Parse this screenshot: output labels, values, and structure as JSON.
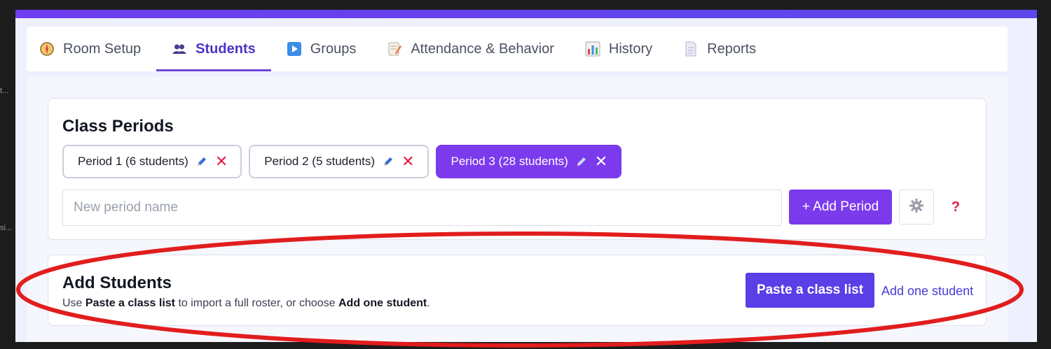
{
  "tabs": [
    {
      "label": "Room Setup",
      "icon": "compass-icon",
      "active": false
    },
    {
      "label": "Students",
      "icon": "people-icon",
      "active": true
    },
    {
      "label": "Groups",
      "icon": "play-icon",
      "active": false
    },
    {
      "label": "Attendance & Behavior",
      "icon": "memo-icon",
      "active": false
    },
    {
      "label": "History",
      "icon": "bar-chart-icon",
      "active": false
    },
    {
      "label": "Reports",
      "icon": "document-icon",
      "active": false
    }
  ],
  "periods": {
    "title": "Class Periods",
    "chips": [
      {
        "label": "Period 1 (6 students)",
        "active": false
      },
      {
        "label": "Period 2 (5 students)",
        "active": false
      },
      {
        "label": "Period 3 (28 students)",
        "active": true
      }
    ],
    "input_placeholder": "New period name",
    "add_label": "+ Add Period",
    "help_label": "?"
  },
  "add_students": {
    "title": "Add Students",
    "desc_pre": "Use ",
    "desc_b1": "Paste a class list",
    "desc_mid": " to import a full roster, or choose ",
    "desc_b2": "Add one student",
    "desc_post": ".",
    "paste_label": "Paste a class list",
    "add_one_label": "Add one student"
  },
  "side_marks": [
    "t...",
    "si..."
  ],
  "colors": {
    "accent": "#7c3aed",
    "primary_button": "#5a3ee6",
    "danger": "#e11d48",
    "annotation": "#e11d1d"
  }
}
